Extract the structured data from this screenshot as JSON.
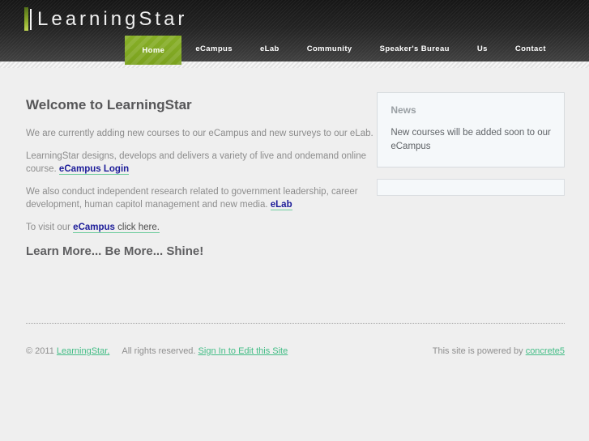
{
  "colors": {
    "accent_green": "#7ba21e",
    "link_green": "#43bd86",
    "link_navy": "#1c1c99",
    "header_dark": "#232323",
    "page_background": "#efefef"
  },
  "header": {
    "logo_text": "LearningStar",
    "nav": [
      {
        "label": "Home"
      },
      {
        "label": "eCampus"
      },
      {
        "label": "eLab"
      },
      {
        "label": "Community"
      },
      {
        "label": "Speaker's Bureau"
      },
      {
        "label": "Us"
      },
      {
        "label": "Contact"
      }
    ]
  },
  "main": {
    "heading": "Welcome to LearningStar",
    "p1": "We are currently adding new courses to our eCampus and new surveys to our eLab.",
    "p2_text": "LearningStar designs, develops and delivers a variety of live and ondemand online course.",
    "p2_link": "eCampus Login",
    "p3_text": "We also conduct independent research related to government leadership, career development, human capitol management and new media.",
    "p3_link": "eLab",
    "p4_text": "To visit our",
    "p4_link_bold": "eCampus",
    "p4_link_rest": "click here.",
    "tagline": "Learn More... Be More... Shine!"
  },
  "sidebar": {
    "news_title": "News",
    "news_body": "New courses will be added soon to our eCampus"
  },
  "footer": {
    "copyright": "© 2011",
    "site_link": "LearningStar,",
    "rights": "All rights reserved.",
    "signin_link": "Sign In to Edit this Site",
    "powered_text": "This site is powered by",
    "powered_link": "concrete5"
  }
}
